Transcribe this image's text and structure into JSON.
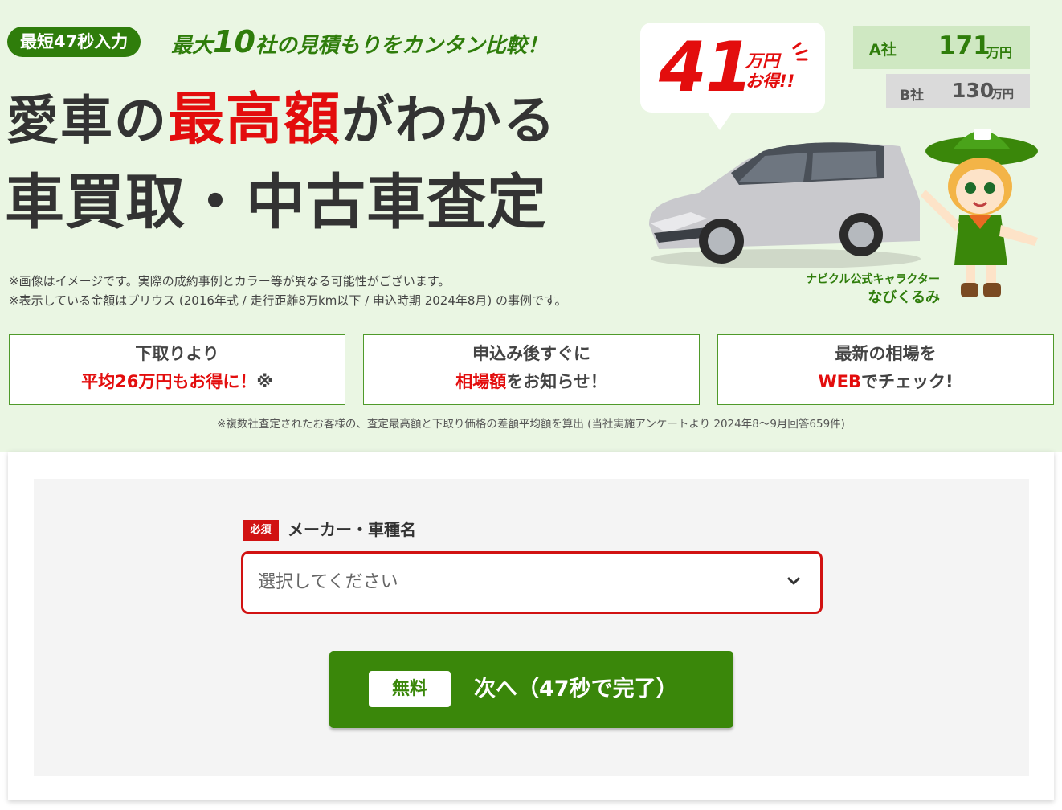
{
  "hero": {
    "pill": "最短47秒入力",
    "tagline_pre": "最大",
    "tagline_num": "10",
    "tagline_post": "社の見積もりをカンタン比較！",
    "title_line1_pre": "愛車の",
    "title_line1_highlight": "最高額",
    "title_line1_post": "がわかる",
    "title_line2": "車買取・中古車査定",
    "notes": [
      "※画像はイメージです。実際の成約事例とカラー等が異なる可能性がございます。",
      "※表示している金額はプリウス (2016年式 / 走行距離8万km以下 / 申込時期 2024年8月) の事例です。"
    ],
    "bubble": {
      "amount": "41",
      "unit_line1": "万円",
      "unit_line2": "お得!!"
    },
    "comparison": [
      {
        "company": "A社",
        "value": "171",
        "unit": "万円"
      },
      {
        "company": "B社",
        "value": "130",
        "unit": "万円"
      }
    ],
    "mascot": {
      "caption": "ナビクル公式キャラクター",
      "name": "なびくるみ"
    },
    "features": [
      {
        "line1": "下取りより",
        "line2_red": "平均26万円もお得に！",
        "line2_rest": "※"
      },
      {
        "line1": "申込み後すぐに",
        "line2_red": "相場額",
        "line2_rest": "をお知らせ！"
      },
      {
        "line1": "最新の相場を",
        "line2_red": "WEB",
        "line2_rest": "でチェック!"
      }
    ],
    "features_note": "※複数社査定されたお客様の、査定最高額と下取り価格の差額平均額を算出 (当社実施アンケートより 2024年8～9月回答659件)"
  },
  "form": {
    "required_badge": "必須",
    "field_label": "メーカー・車種名",
    "select_placeholder": "選択してください",
    "button_free": "無料",
    "button_label": "次へ（47秒で完了）"
  },
  "colors": {
    "hero_bg": "#eaf6e3",
    "brand_green": "#2f7d0b",
    "button_green": "#3a870a",
    "accent_red": "#e30d0d"
  }
}
